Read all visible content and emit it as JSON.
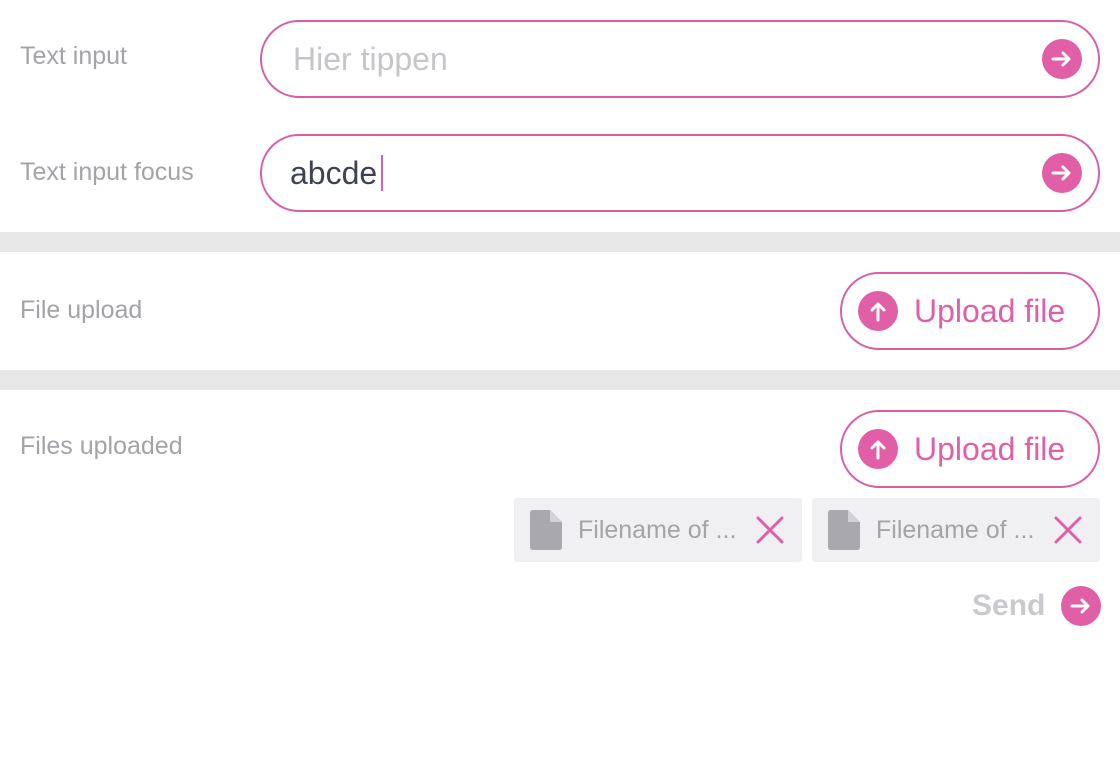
{
  "text_input": {
    "label": "Text input",
    "placeholder": "Hier tippen"
  },
  "text_input_focus": {
    "label": "Text input focus",
    "value": "abcde"
  },
  "file_upload": {
    "label": "File upload",
    "button_label": "Upload file"
  },
  "files_uploaded": {
    "label": "Files uploaded",
    "button_label": "Upload file",
    "files": [
      {
        "name": "Filename of ..."
      },
      {
        "name": "Filename of ..."
      }
    ],
    "send_label": "Send"
  },
  "colors": {
    "accent": "#e05fa6",
    "label": "#a3a3a8",
    "divider": "#e8e8e8",
    "chip_bg": "#f0f0f2"
  },
  "icons": {
    "submit": "arrow-right-icon",
    "upload": "arrow-up-icon",
    "file": "file-icon",
    "remove": "close-icon"
  }
}
